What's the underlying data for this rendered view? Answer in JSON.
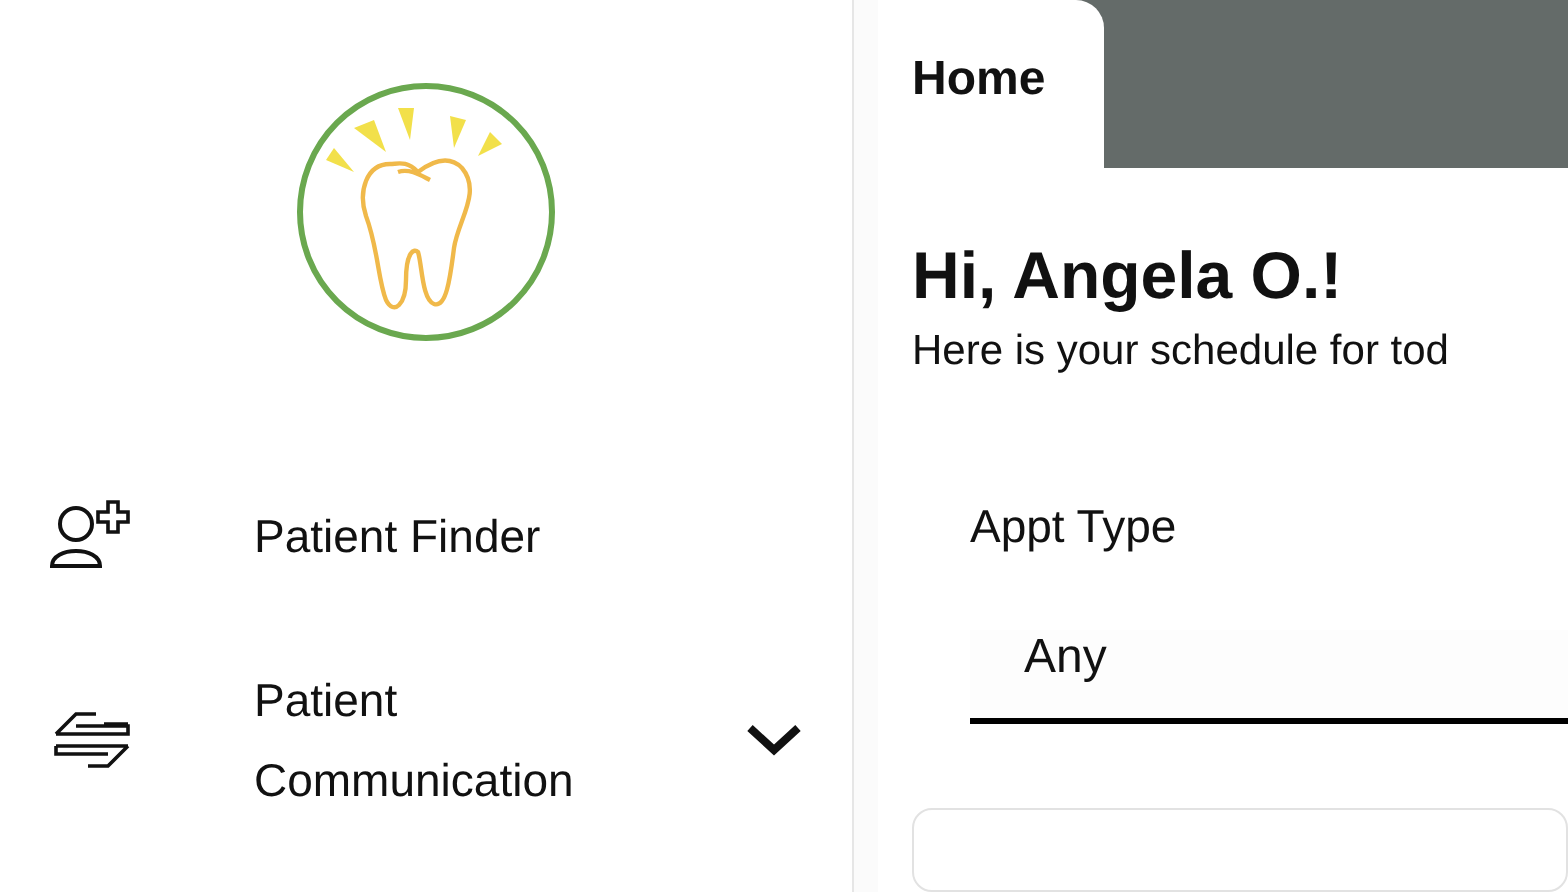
{
  "sidebar": {
    "items": [
      {
        "label": "Patient Finder",
        "kind": "finder"
      },
      {
        "label": "Patient Communication",
        "kind": "communication",
        "expanded": false
      }
    ]
  },
  "tabs": [
    {
      "label": "Home",
      "selected": true
    }
  ],
  "greeting": "Hi, Angela O.!",
  "subtitle": "Here is your schedule for tod",
  "filter": {
    "label": "Appt Type",
    "value": "Any"
  }
}
